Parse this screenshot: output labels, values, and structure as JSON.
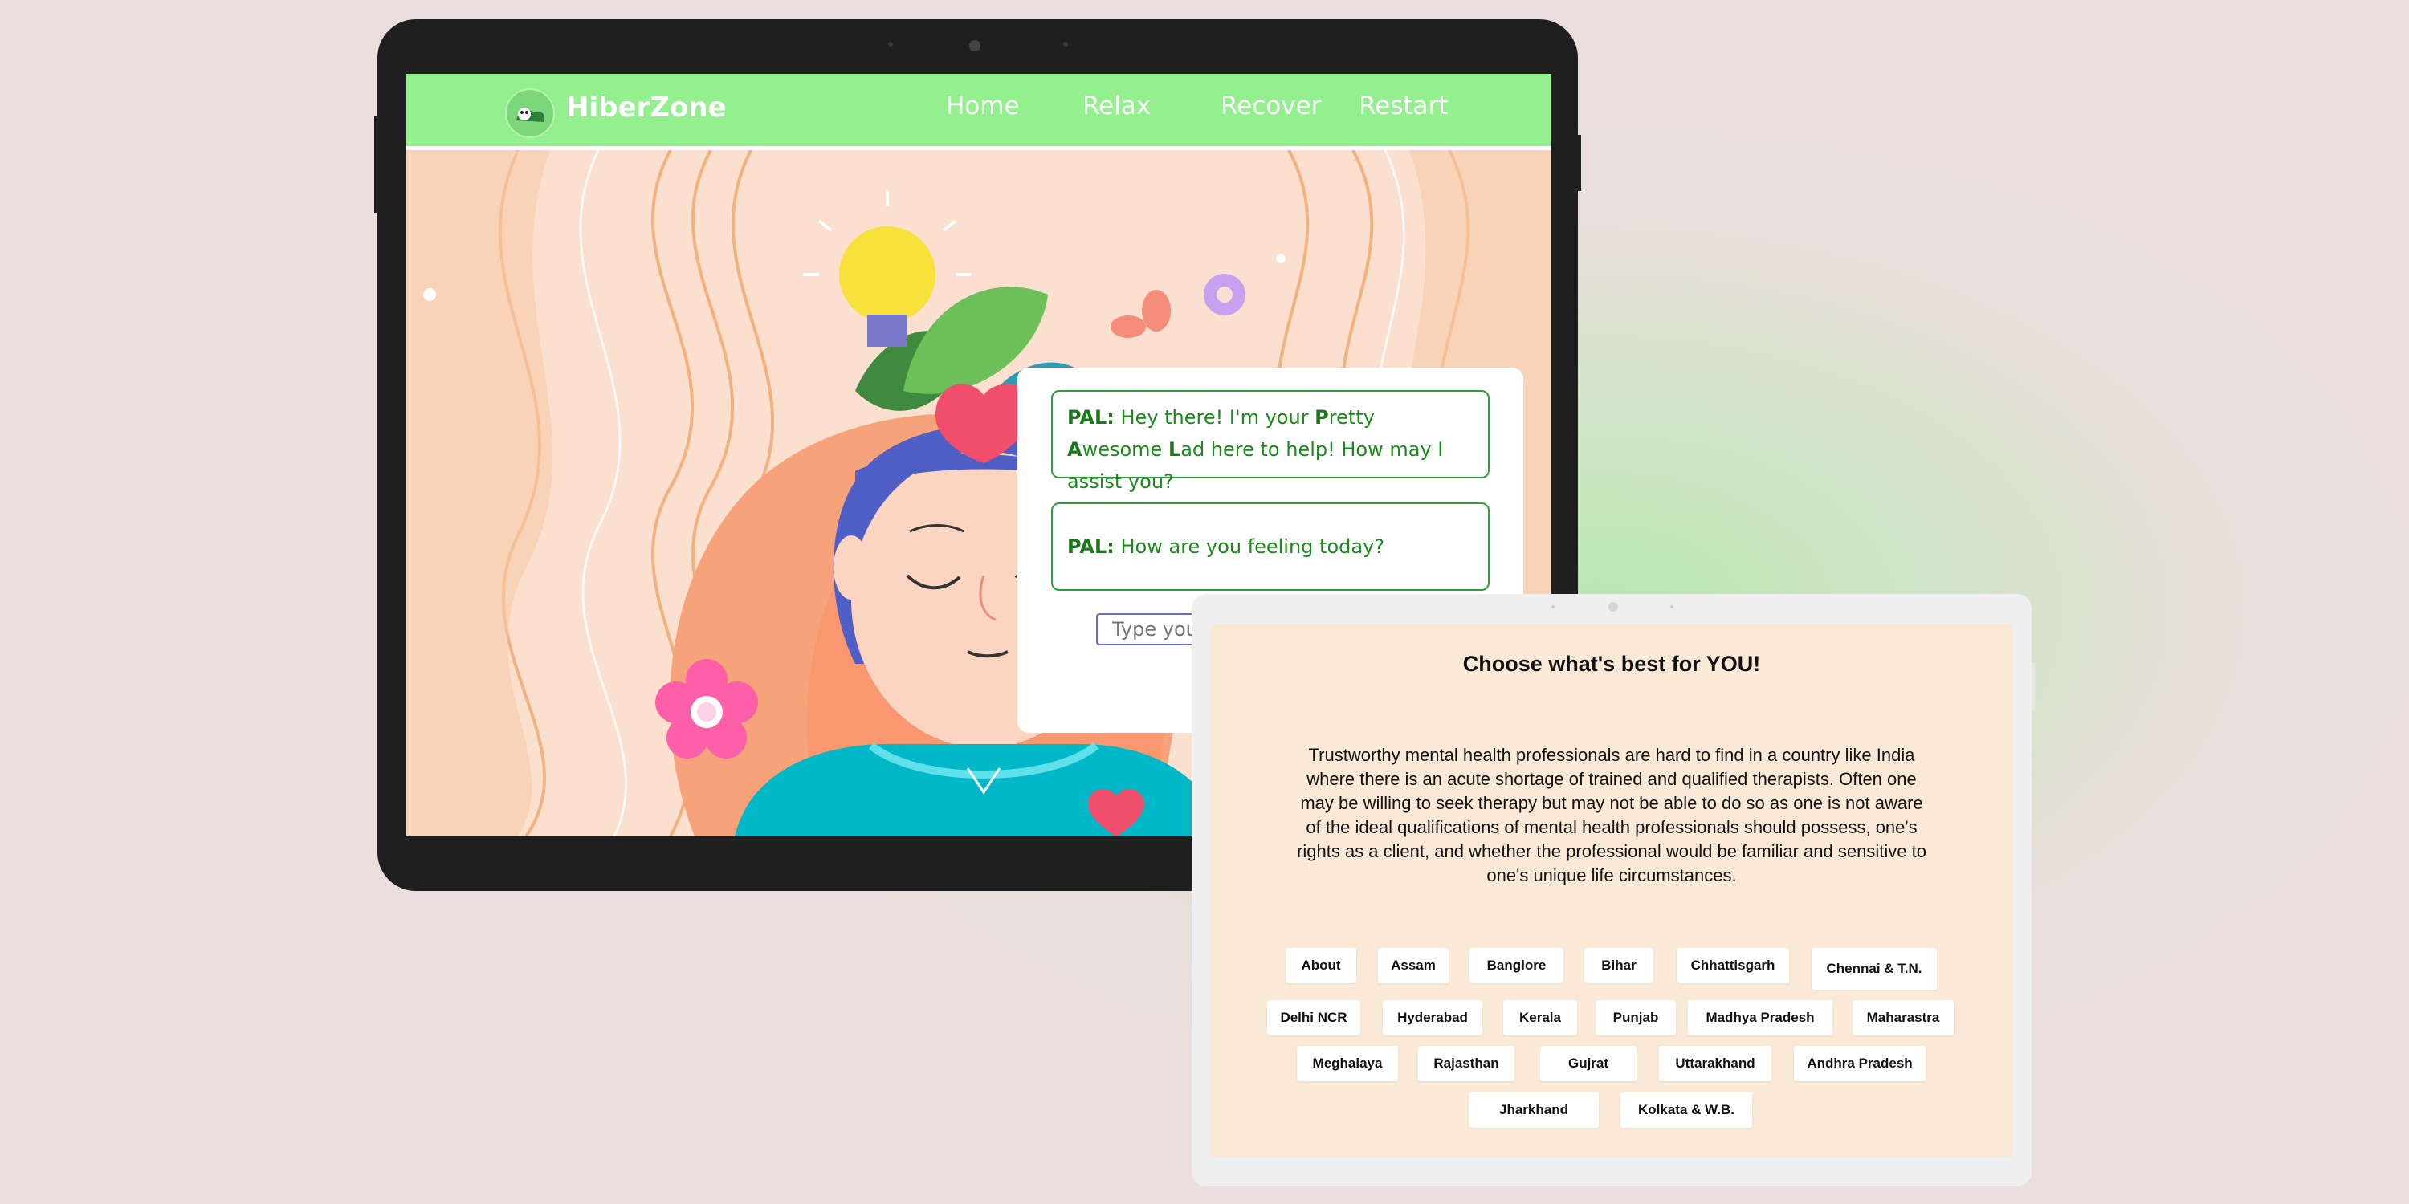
{
  "app": {
    "brand": "HiberZone",
    "nav": [
      "Home",
      "Relax",
      "Recover",
      "Restart"
    ]
  },
  "chat": {
    "bot_name": "PAL:",
    "message1_parts": [
      "Hey there! I'm your ",
      "P",
      "retty ",
      "A",
      "wesome ",
      "L",
      "ad here to help! How may I assist you?"
    ],
    "message2": "How are you feeling today?",
    "input_placeholder": "Type your"
  },
  "therapy": {
    "title": "Choose what's best for YOU!",
    "description": "Trustworthy mental health professionals are hard to find in a country like India where there is an acute shortage of trained and qualified therapists. Often one may be willing to seek therapy but may not be able to do so as one is not aware of the ideal qualifications of mental health professionals should possess, one's rights as a client, and whether the professional would be familiar and sensitive to one's unique life circumstances.",
    "regions": [
      "About",
      "Assam",
      "Banglore",
      "Bihar",
      "Chhattisgarh",
      "Chennai & T.N.",
      "Delhi NCR",
      "Hyderabad",
      "Kerala",
      "Punjab",
      "Madhya Pradesh",
      "Maharastra",
      "Meghalaya",
      "Rajasthan",
      "Gujrat",
      "Uttarakhand",
      "Andhra Pradesh",
      "Jharkhand",
      "Kolkata & W.B."
    ]
  },
  "colors": {
    "nav_bg": "#94ef8f",
    "accent_green": "#1a8a1a",
    "art_bg": "#fbe0cf",
    "panel_bg": "#f9e9d6"
  }
}
